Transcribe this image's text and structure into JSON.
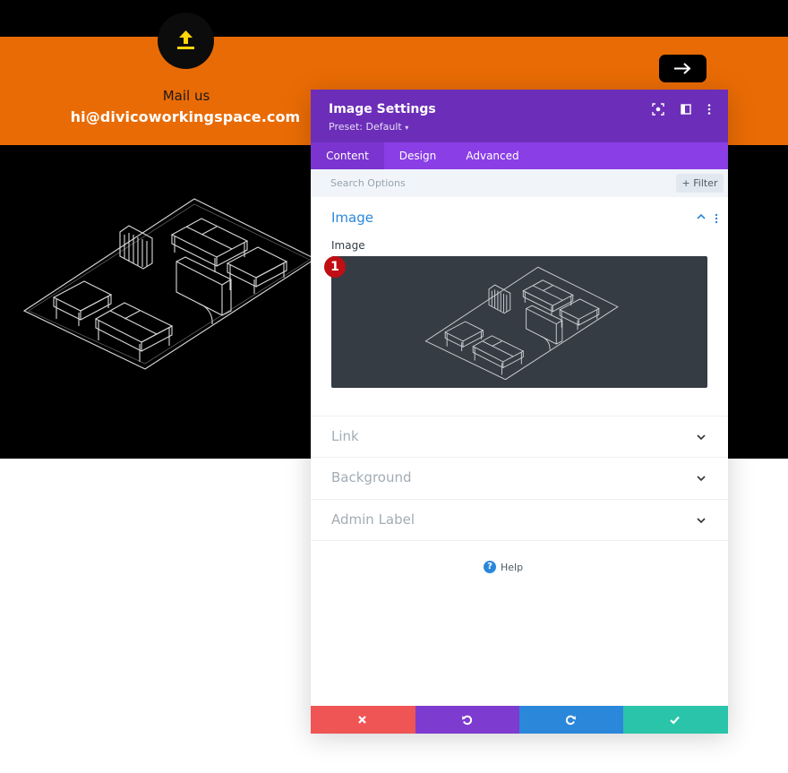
{
  "page": {
    "mail_label": "Mail us",
    "mail_email": "hi@divicoworkingspace.com",
    "icons": {
      "upload": "upload-icon",
      "next": "arrow-right-icon"
    },
    "colors": {
      "orange": "#e96b05",
      "black": "#000000",
      "upload_icon": "#ffd60a"
    }
  },
  "modal": {
    "title": "Image Settings",
    "preset": "Preset: Default",
    "header_icons": [
      "focus-icon",
      "sidebar-layout-icon",
      "more-vertical-icon"
    ],
    "tabs": [
      {
        "label": "Content",
        "active": true
      },
      {
        "label": "Design",
        "active": false
      },
      {
        "label": "Advanced",
        "active": false
      }
    ],
    "search": {
      "placeholder": "Search Options",
      "value": ""
    },
    "filter_label": "Filter",
    "image_section": {
      "title": "Image",
      "field_label": "Image",
      "badge": "1"
    },
    "collapsed_sections": [
      {
        "label": "Link"
      },
      {
        "label": "Background"
      },
      {
        "label": "Admin Label"
      }
    ],
    "help_label": "Help",
    "footer_buttons": [
      {
        "name": "discard",
        "icon": "close-icon",
        "color": "#ef5555"
      },
      {
        "name": "undo",
        "icon": "undo-icon",
        "color": "#7e3bd0"
      },
      {
        "name": "redo",
        "icon": "redo-icon",
        "color": "#2b87da"
      },
      {
        "name": "save",
        "icon": "check-icon",
        "color": "#29c4a9"
      }
    ],
    "colors": {
      "header": "#6c2eb9",
      "tabs": "#8a3ee6",
      "accent": "#2b87da"
    }
  }
}
